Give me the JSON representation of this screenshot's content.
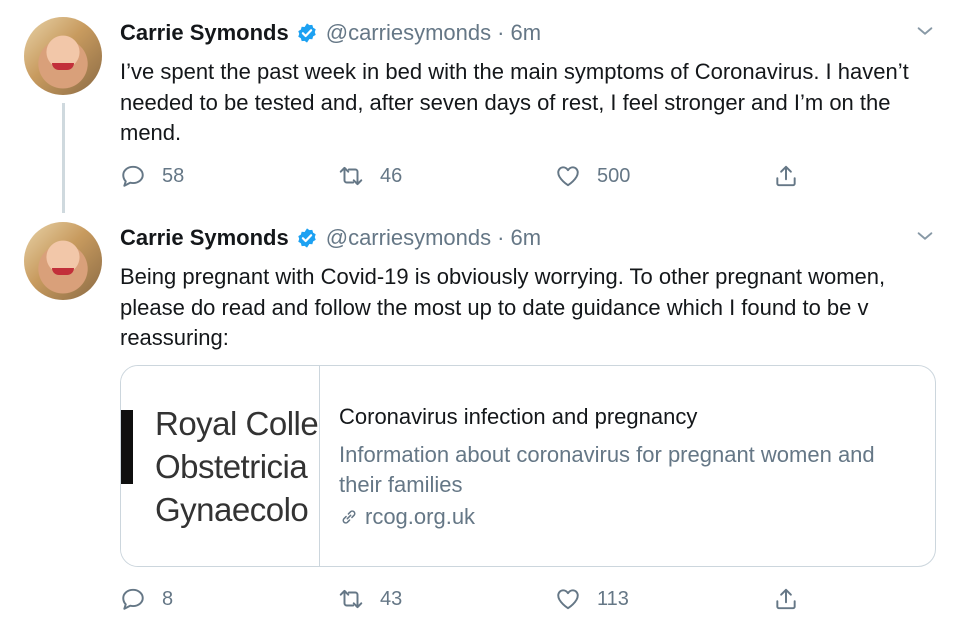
{
  "tweets": [
    {
      "author": {
        "name": "Carrie Symonds",
        "handle": "@carriesymonds",
        "verified": true
      },
      "time": "6m",
      "text": "I’ve spent the past week in bed with the main symptoms of Coronavirus. I haven’t needed to be tested and, after seven days of rest, I feel stronger and I’m on the mend.",
      "actions": {
        "replies": "58",
        "retweets": "46",
        "likes": "500"
      }
    },
    {
      "author": {
        "name": "Carrie Symonds",
        "handle": "@carriesymonds",
        "verified": true
      },
      "time": "6m",
      "text": "Being pregnant with Covid-19 is obviously worrying. To other pregnant women, please do read and follow the most up to date guidance which I found to be v reassuring:",
      "card": {
        "thumbnail_lines": [
          "Royal Colle",
          "Obstetricia",
          "Gynaecolo"
        ],
        "title": "Coronavirus infection and pregnancy",
        "description": "Information about coronavirus for pregnant women and their families",
        "domain": "rcog.org.uk"
      },
      "actions": {
        "replies": "8",
        "retweets": "43",
        "likes": "113"
      }
    }
  ],
  "separator": "·",
  "colors": {
    "verified": "#1da1f2",
    "text": "#14171a",
    "secondary": "#657786",
    "border": "#ccd6dd"
  },
  "icons": [
    "verified-badge-icon",
    "chevron-down-icon",
    "reply-icon",
    "retweet-icon",
    "like-icon",
    "share-icon",
    "link-icon"
  ]
}
